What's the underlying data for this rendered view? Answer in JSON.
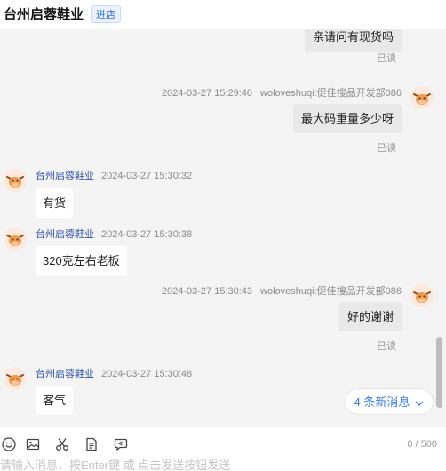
{
  "header": {
    "shop_name": "台州启蓉鞋业",
    "enter_label": "进店"
  },
  "messages": [
    {
      "side": "right",
      "time": "",
      "sender": "",
      "text": "亲请问有现货吗",
      "read": "已读"
    },
    {
      "side": "right",
      "time": "2024-03-27 15:29:40",
      "sender": "woloveshuqi:促佳搜品开发部086",
      "text": "最大码重量多少呀",
      "read": "已读"
    },
    {
      "side": "left",
      "time": "2024-03-27 15:30:32",
      "sender": "台州启蓉鞋业",
      "text": "有货"
    },
    {
      "side": "left",
      "time": "2024-03-27 15:30:38",
      "sender": "台州启蓉鞋业",
      "text": "320克左右老板"
    },
    {
      "side": "right",
      "time": "2024-03-27 15:30:43",
      "sender": "woloveshuqi:促佳搜品开发部086",
      "text": "好的谢谢",
      "read": "已读"
    },
    {
      "side": "left",
      "time": "2024-03-27 15:30:48",
      "sender": "台州启蓉鞋业",
      "text": "客气"
    }
  ],
  "new_messages_label": "4 条新消息",
  "toolbar": {
    "icons": [
      "smile-icon",
      "image-icon",
      "scissors-icon",
      "file-icon",
      "history-icon"
    ],
    "counter": "0 / 500"
  },
  "input": {
    "placeholder": "请输入消息，按Enter键 或 点击发送按钮发送"
  },
  "colors": {
    "accent": "#3a7ee6",
    "chat_bg": "#f4f4f4",
    "sender_name": "#2b4ea3"
  }
}
